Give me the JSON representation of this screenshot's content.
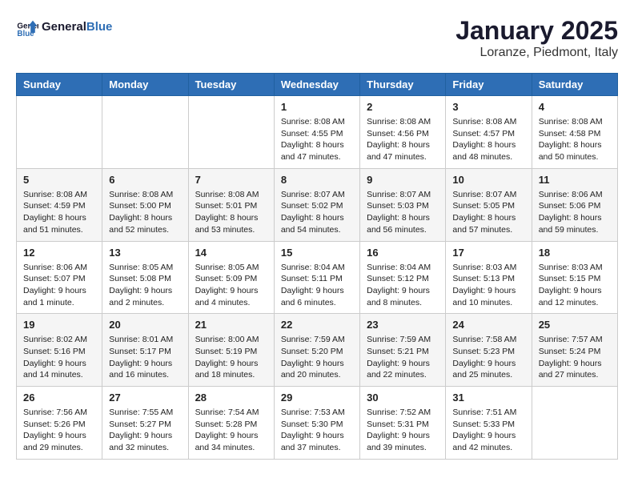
{
  "header": {
    "logo_line1": "General",
    "logo_line2": "Blue",
    "month": "January 2025",
    "location": "Loranze, Piedmont, Italy"
  },
  "days_of_week": [
    "Sunday",
    "Monday",
    "Tuesday",
    "Wednesday",
    "Thursday",
    "Friday",
    "Saturday"
  ],
  "weeks": [
    [
      {
        "day": "",
        "info": ""
      },
      {
        "day": "",
        "info": ""
      },
      {
        "day": "",
        "info": ""
      },
      {
        "day": "1",
        "info": "Sunrise: 8:08 AM\nSunset: 4:55 PM\nDaylight: 8 hours and 47 minutes."
      },
      {
        "day": "2",
        "info": "Sunrise: 8:08 AM\nSunset: 4:56 PM\nDaylight: 8 hours and 47 minutes."
      },
      {
        "day": "3",
        "info": "Sunrise: 8:08 AM\nSunset: 4:57 PM\nDaylight: 8 hours and 48 minutes."
      },
      {
        "day": "4",
        "info": "Sunrise: 8:08 AM\nSunset: 4:58 PM\nDaylight: 8 hours and 50 minutes."
      }
    ],
    [
      {
        "day": "5",
        "info": "Sunrise: 8:08 AM\nSunset: 4:59 PM\nDaylight: 8 hours and 51 minutes."
      },
      {
        "day": "6",
        "info": "Sunrise: 8:08 AM\nSunset: 5:00 PM\nDaylight: 8 hours and 52 minutes."
      },
      {
        "day": "7",
        "info": "Sunrise: 8:08 AM\nSunset: 5:01 PM\nDaylight: 8 hours and 53 minutes."
      },
      {
        "day": "8",
        "info": "Sunrise: 8:07 AM\nSunset: 5:02 PM\nDaylight: 8 hours and 54 minutes."
      },
      {
        "day": "9",
        "info": "Sunrise: 8:07 AM\nSunset: 5:03 PM\nDaylight: 8 hours and 56 minutes."
      },
      {
        "day": "10",
        "info": "Sunrise: 8:07 AM\nSunset: 5:05 PM\nDaylight: 8 hours and 57 minutes."
      },
      {
        "day": "11",
        "info": "Sunrise: 8:06 AM\nSunset: 5:06 PM\nDaylight: 8 hours and 59 minutes."
      }
    ],
    [
      {
        "day": "12",
        "info": "Sunrise: 8:06 AM\nSunset: 5:07 PM\nDaylight: 9 hours and 1 minute."
      },
      {
        "day": "13",
        "info": "Sunrise: 8:05 AM\nSunset: 5:08 PM\nDaylight: 9 hours and 2 minutes."
      },
      {
        "day": "14",
        "info": "Sunrise: 8:05 AM\nSunset: 5:09 PM\nDaylight: 9 hours and 4 minutes."
      },
      {
        "day": "15",
        "info": "Sunrise: 8:04 AM\nSunset: 5:11 PM\nDaylight: 9 hours and 6 minutes."
      },
      {
        "day": "16",
        "info": "Sunrise: 8:04 AM\nSunset: 5:12 PM\nDaylight: 9 hours and 8 minutes."
      },
      {
        "day": "17",
        "info": "Sunrise: 8:03 AM\nSunset: 5:13 PM\nDaylight: 9 hours and 10 minutes."
      },
      {
        "day": "18",
        "info": "Sunrise: 8:03 AM\nSunset: 5:15 PM\nDaylight: 9 hours and 12 minutes."
      }
    ],
    [
      {
        "day": "19",
        "info": "Sunrise: 8:02 AM\nSunset: 5:16 PM\nDaylight: 9 hours and 14 minutes."
      },
      {
        "day": "20",
        "info": "Sunrise: 8:01 AM\nSunset: 5:17 PM\nDaylight: 9 hours and 16 minutes."
      },
      {
        "day": "21",
        "info": "Sunrise: 8:00 AM\nSunset: 5:19 PM\nDaylight: 9 hours and 18 minutes."
      },
      {
        "day": "22",
        "info": "Sunrise: 7:59 AM\nSunset: 5:20 PM\nDaylight: 9 hours and 20 minutes."
      },
      {
        "day": "23",
        "info": "Sunrise: 7:59 AM\nSunset: 5:21 PM\nDaylight: 9 hours and 22 minutes."
      },
      {
        "day": "24",
        "info": "Sunrise: 7:58 AM\nSunset: 5:23 PM\nDaylight: 9 hours and 25 minutes."
      },
      {
        "day": "25",
        "info": "Sunrise: 7:57 AM\nSunset: 5:24 PM\nDaylight: 9 hours and 27 minutes."
      }
    ],
    [
      {
        "day": "26",
        "info": "Sunrise: 7:56 AM\nSunset: 5:26 PM\nDaylight: 9 hours and 29 minutes."
      },
      {
        "day": "27",
        "info": "Sunrise: 7:55 AM\nSunset: 5:27 PM\nDaylight: 9 hours and 32 minutes."
      },
      {
        "day": "28",
        "info": "Sunrise: 7:54 AM\nSunset: 5:28 PM\nDaylight: 9 hours and 34 minutes."
      },
      {
        "day": "29",
        "info": "Sunrise: 7:53 AM\nSunset: 5:30 PM\nDaylight: 9 hours and 37 minutes."
      },
      {
        "day": "30",
        "info": "Sunrise: 7:52 AM\nSunset: 5:31 PM\nDaylight: 9 hours and 39 minutes."
      },
      {
        "day": "31",
        "info": "Sunrise: 7:51 AM\nSunset: 5:33 PM\nDaylight: 9 hours and 42 minutes."
      },
      {
        "day": "",
        "info": ""
      }
    ]
  ]
}
